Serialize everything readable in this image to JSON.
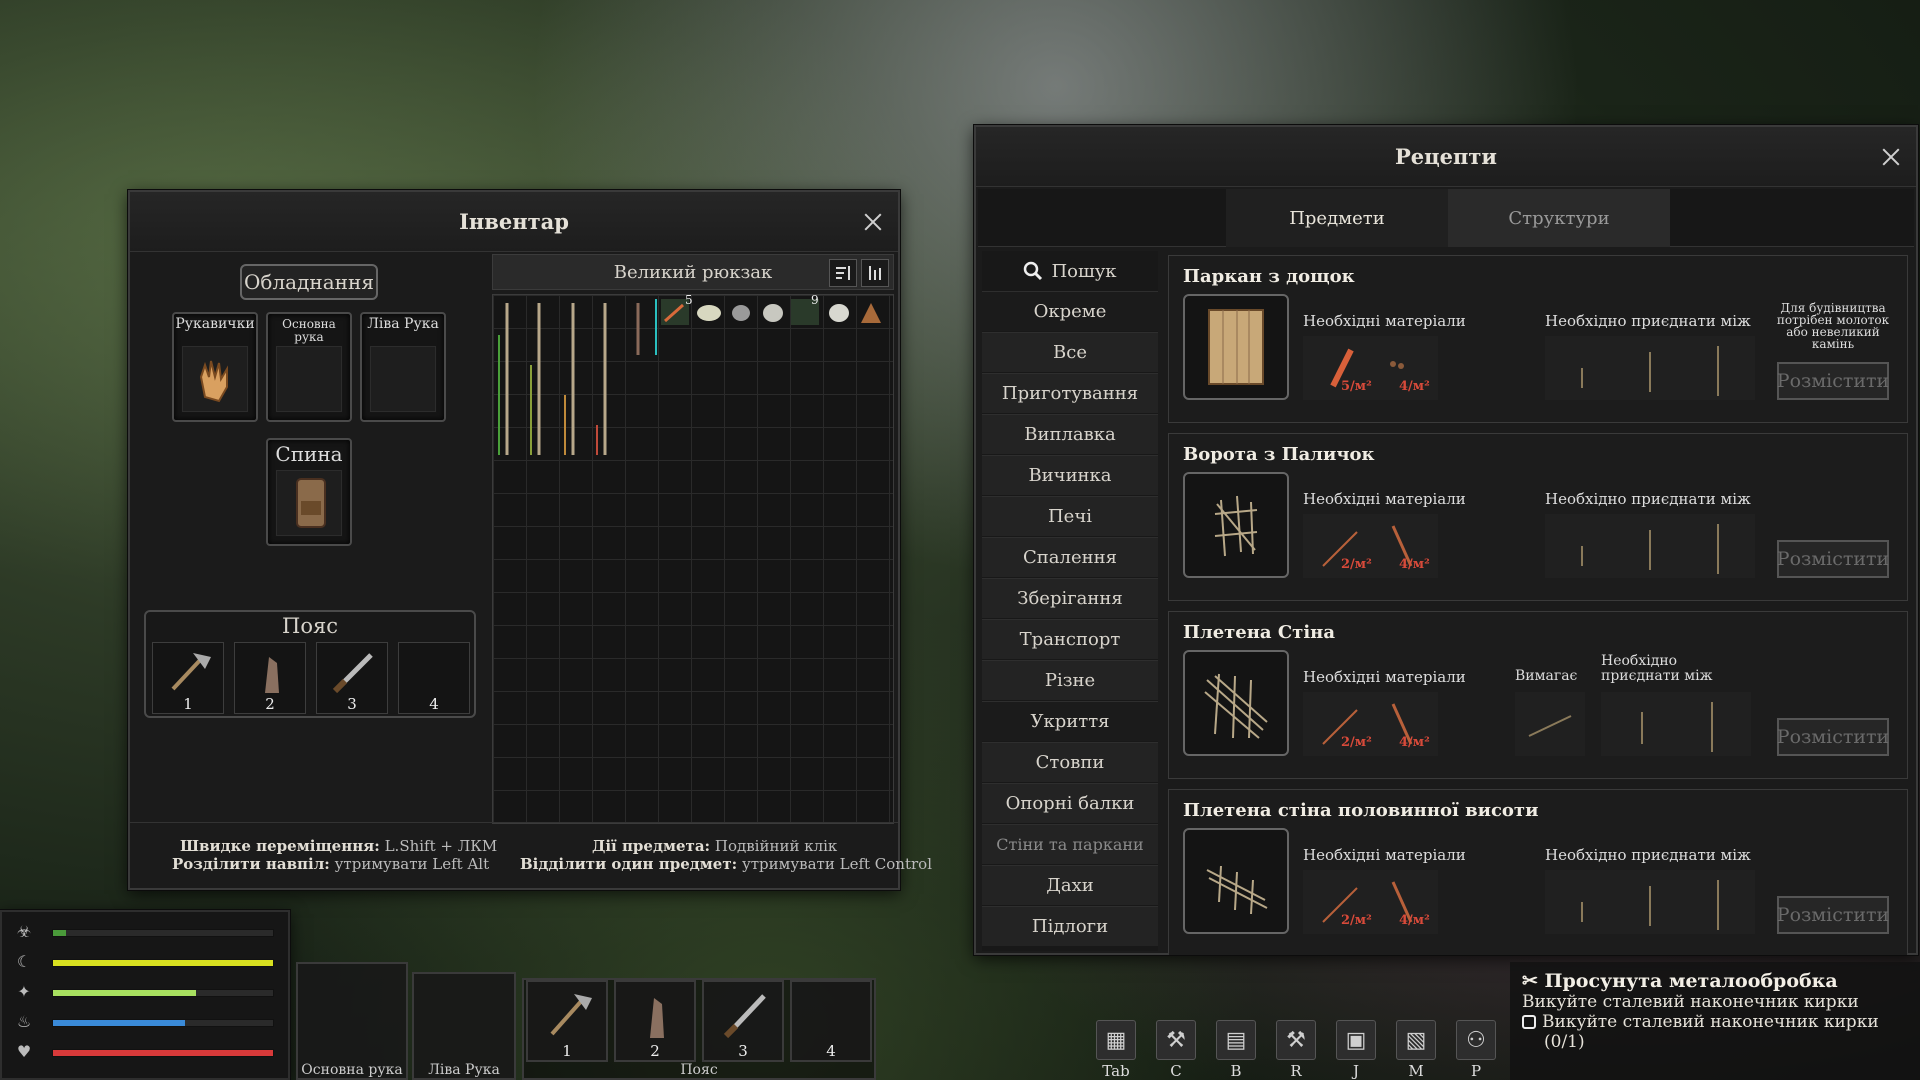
{
  "inventory": {
    "title": "Інвентар",
    "equipment_label": "Обладнання",
    "slots": {
      "gloves": "Рукавички",
      "main_hand": "Основна рука",
      "left_hand": "Ліва Рука",
      "back": "Спина"
    },
    "belt": {
      "title": "Пояс",
      "numbers": [
        "1",
        "2",
        "3",
        "4"
      ]
    },
    "backpack_title": "Великий рюкзак",
    "stack_counts": [
      "5",
      "9"
    ],
    "hints": {
      "quick_move_label": "Швидке переміщення:",
      "quick_move_value": "L.Shift + ЛКМ",
      "split_label": "Розділити навпіл:",
      "split_value": "утримувати Left Alt",
      "actions_label": "Дії предмета:",
      "actions_value": "Подвійний клік",
      "separate_label": "Відділити один предмет:",
      "separate_value": "утримувати Left Control"
    }
  },
  "recipes": {
    "title": "Рецепти",
    "tabs": [
      "Предмети",
      "Структури"
    ],
    "search_label": "Пошук",
    "categories": [
      {
        "label": "Окреме",
        "kind": "header"
      },
      {
        "label": "Все",
        "kind": "item"
      },
      {
        "label": "Приготування",
        "kind": "item"
      },
      {
        "label": "Виплавка",
        "kind": "item"
      },
      {
        "label": "Вичинка",
        "kind": "item"
      },
      {
        "label": "Печі",
        "kind": "item"
      },
      {
        "label": "Спалення",
        "kind": "item"
      },
      {
        "label": "Зберігання",
        "kind": "item"
      },
      {
        "label": "Транспорт",
        "kind": "item"
      },
      {
        "label": "Різне",
        "kind": "item"
      },
      {
        "label": "Укриття",
        "kind": "header"
      },
      {
        "label": "Стовпи",
        "kind": "item"
      },
      {
        "label": "Опорні балки",
        "kind": "item"
      },
      {
        "label": "Стіни та паркани",
        "kind": "dim"
      },
      {
        "label": "Дахи",
        "kind": "item"
      },
      {
        "label": "Підлоги",
        "kind": "item"
      }
    ],
    "items": [
      {
        "name": "Паркан з дощок",
        "materials_label": "Необхідні матеріали",
        "attach_label": "Необхідно приєднати між",
        "note": "Для будівництва потрібен молоток або невеликий камінь",
        "qty": [
          "5/м²",
          "4/м²"
        ],
        "place": "Розмістити"
      },
      {
        "name": "Ворота з Паличок",
        "materials_label": "Необхідні матеріали",
        "attach_label": "Необхідно приєднати між",
        "qty": [
          "2/м²",
          "4/м²"
        ],
        "place": "Розмістити"
      },
      {
        "name": "Плетена Стіна",
        "materials_label": "Необхідні матеріали",
        "requires_label": "Вимагає",
        "attach_label": "Необхідно приєднати між",
        "qty": [
          "2/м²",
          "4/м²"
        ],
        "place": "Розмістити"
      },
      {
        "name": "Плетена стіна половинної висоти",
        "materials_label": "Необхідні матеріали",
        "attach_label": "Необхідно приєднати між",
        "qty": [
          "2/м²",
          "4/м²"
        ],
        "place": "Розмістити"
      }
    ]
  },
  "status": {
    "bars": [
      {
        "icon": "brain-icon",
        "value": 0.06,
        "color": "#4a9a3a"
      },
      {
        "icon": "stomach-icon",
        "value": 1.0,
        "color": "#d8e020"
      },
      {
        "icon": "meat-icon",
        "value": 0.65,
        "color": "#a8e060"
      },
      {
        "icon": "water-icon",
        "value": 0.6,
        "color": "#3a8ad8"
      },
      {
        "icon": "heart-icon",
        "value": 1.0,
        "color": "#d83a3a"
      }
    ]
  },
  "hotbar": {
    "main_hand": "Основна рука",
    "left_hand": "Ліва Рука",
    "belt": "Пояс",
    "numbers": [
      "1",
      "2",
      "3",
      "4"
    ]
  },
  "quick_keys": [
    "Tab",
    "C",
    "B",
    "R",
    "J",
    "M",
    "P"
  ],
  "quest": {
    "title": "Просунута металообробка",
    "line1": "Викуйте сталевий наконечник кирки",
    "check": "Викуйте сталевий наконечник кирки",
    "progress": "(0/1)"
  }
}
